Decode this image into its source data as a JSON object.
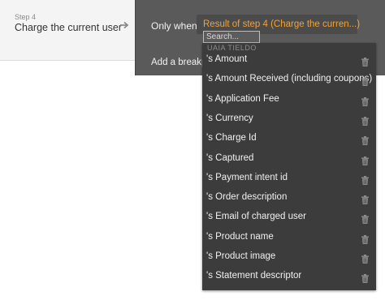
{
  "step": {
    "number_label": "Step 4",
    "title": "Charge the current user",
    "arrow_icon": "arrow-right-icon"
  },
  "condition": {
    "only_when_label": "Only when",
    "expression": "Result of step 4 (Charge the curren...)",
    "search_placeholder": "Search...",
    "add_breakpoint_label": "Add a breakp"
  },
  "dropdown": {
    "cutoff_text": "UAIA TIELDO",
    "items": [
      {
        "label": "'s Amount"
      },
      {
        "label": "'s Amount Received (including coupons)"
      },
      {
        "label": "'s Application Fee"
      },
      {
        "label": "'s Currency"
      },
      {
        "label": "'s Charge Id"
      },
      {
        "label": "'s Captured"
      },
      {
        "label": "'s Payment intent id"
      },
      {
        "label": "'s Order description"
      },
      {
        "label": "'s Email of charged user"
      },
      {
        "label": "'s Product name"
      },
      {
        "label": "'s Product image"
      },
      {
        "label": "'s Statement descriptor"
      }
    ],
    "item_icon": "trash-icon"
  },
  "colors": {
    "expression_text": "#f0a33a",
    "panel_bg": "#5a5a5a",
    "dropdown_bg": "#3c3c3c"
  }
}
